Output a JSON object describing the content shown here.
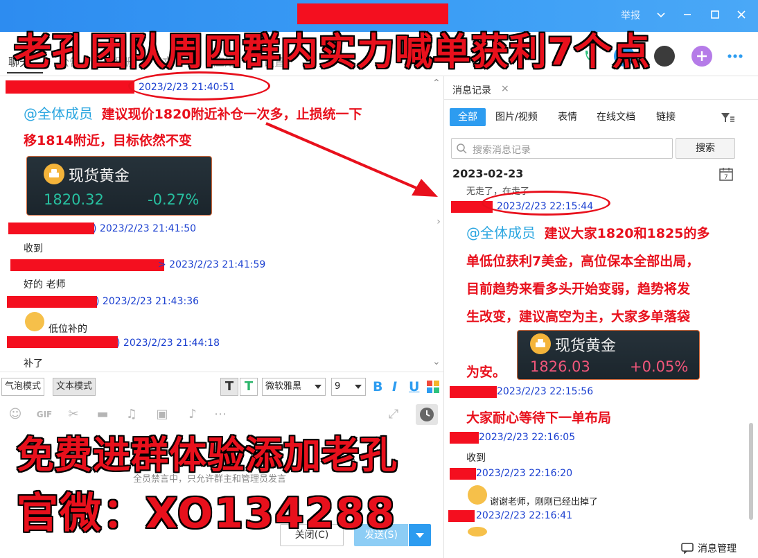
{
  "banners": {
    "top": "老孔团队周四群内实力喊单获利7个点",
    "mid": "免费进群体验添加老孔",
    "bottom": "官微：XO134288"
  },
  "titlebar": {
    "report": "举报"
  },
  "header": {
    "tabs": [
      "聊天",
      "公告",
      "相册",
      "文件",
      "应用",
      "设置"
    ]
  },
  "left_messages": {
    "m1_ts": "2023/2/23 21:40:51",
    "m1_at": "@全体成员",
    "m1_line1": "建议现价1820附近补仓一次多，止损统一下",
    "m1_line2": "移1814附近，目标依然不变",
    "m2_ts": ") 2023/2/23 21:41:50",
    "m2_text": "收到",
    "m3_ts": "> 2023/2/23 21:41:59",
    "m3_text": "好的 老师",
    "m4_ts": ") 2023/2/23 21:43:36",
    "m4_text": "低位补的",
    "m5_ts": ") 2023/2/23 21:44:18",
    "m5_text": "补了"
  },
  "gold_card_left": {
    "title": "现货黄金",
    "price": "1820.32",
    "change": "-0.27%",
    "change_color": "#27c0a0"
  },
  "toolbar": {
    "bubble_mode": "气泡模式",
    "text_mode": "文本模式",
    "font": "微软雅黑",
    "size": "9"
  },
  "input": {
    "mute_note": "全员禁言中，只允许群主和管理员发言",
    "close_label": "关闭(C)",
    "send_label": "发送(S)"
  },
  "right_panel": {
    "tab_title": "消息记录",
    "filters": [
      "全部",
      "图片/视频",
      "表情",
      "在线文档",
      "链接"
    ],
    "search_placeholder": "搜索消息记录",
    "search_button": "搜索",
    "date": "2023-02-23",
    "partial_top": "无走了，在走了",
    "r1_ts": "2023/2/23 22:15:44",
    "r1_at": "@全体成员",
    "r1_l1": "建议大家1820和1825的多",
    "r1_l2": "单低位获利7美金，高位保本全部出局，",
    "r1_l3": "目前趋势来看多头开始变弱，趋势将发",
    "r1_l4": "生改变，建议高空为主，大家多单落袋",
    "r1_l5": "为安。",
    "r2_ts": "2023/2/23 22:15:56",
    "r2_text": "大家耐心等待下一单布局",
    "r3_ts": "2023/2/23 22:16:05",
    "r3_text": "收到",
    "r4_ts": "2023/2/23 22:16:20",
    "r4_text": "谢谢老师，刚刚已经出掉了",
    "r5_ts": "2023/2/23 22:16:41",
    "footer": "消息管理"
  },
  "gold_card_right": {
    "title": "现货黄金",
    "price": "1826.03",
    "change": "+0.05%",
    "change_color": "#f0567a"
  },
  "colors": {
    "accent": "#2d9cf0",
    "annotation_red": "#e8101c",
    "timestamp_blue": "#1a3fd0"
  }
}
